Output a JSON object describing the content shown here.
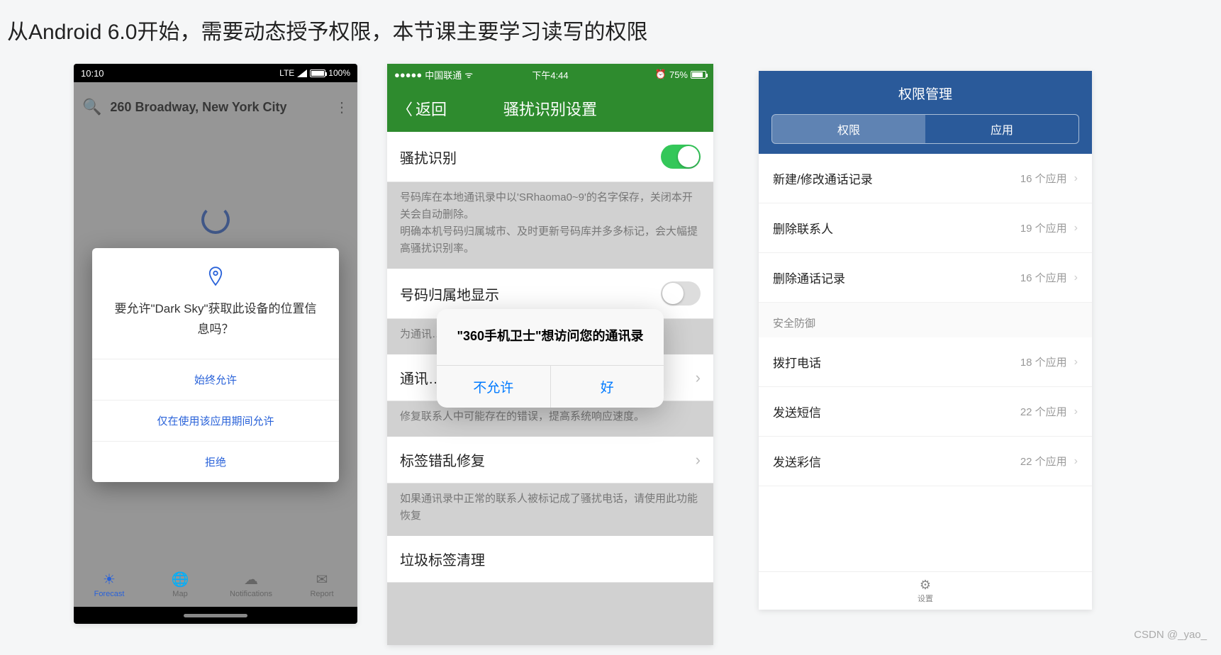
{
  "heading": "从Android 6.0开始，需要动态授予权限，本节课主要学习读写的权限",
  "watermark": "CSDN @_yao_",
  "phone1": {
    "status_time": "10:10",
    "status_lte": "LTE",
    "status_batt": "100%",
    "header_address": "260 Broadway, New York City",
    "dialog_text": "要允许\"Dark Sky\"获取此设备的位置信息吗？",
    "btn_always": "始终允许",
    "btn_while": "仅在使用该应用期间允许",
    "btn_deny": "拒绝",
    "tabs": [
      {
        "icon": "☀",
        "label": "Forecast"
      },
      {
        "icon": "🌐",
        "label": "Map"
      },
      {
        "icon": "☁",
        "label": "Notifications"
      },
      {
        "icon": "✉",
        "label": "Report"
      }
    ]
  },
  "phone2": {
    "carrier": "中国联通",
    "time": "下午4:44",
    "batt": "75%",
    "back": "返回",
    "title": "骚扰识别设置",
    "row1": "骚扰识别",
    "desc1": "号码库在本地通讯录中以'SRhaoma0~9'的名字保存，关闭本开关会自动删除。\n明确本机号码归属城市、及时更新号码库并多多标记，会大幅提高骚扰识别率。",
    "row2": "号码归属地显示",
    "desc2": "为通讯…",
    "row3": "通讯…",
    "desc3": "修复联系人中可能存在的错误，提高系统响应速度。",
    "row4": "标签错乱修复",
    "desc4": "如果通讯录中正常的联系人被标记成了骚扰电话，请使用此功能恢复",
    "row5": "垃圾标签清理",
    "alert_title": "\"360手机卫士\"想访问您的通讯录",
    "alert_deny": "不允许",
    "alert_ok": "好"
  },
  "phone3": {
    "title": "权限管理",
    "seg_perm": "权限",
    "seg_app": "应用",
    "items": [
      {
        "label": "新建/修改通话记录",
        "val": "16 个应用"
      },
      {
        "label": "删除联系人",
        "val": "19 个应用"
      },
      {
        "label": "删除通话记录",
        "val": "16 个应用"
      }
    ],
    "section": "安全防御",
    "items2": [
      {
        "label": "拨打电话",
        "val": "18 个应用"
      },
      {
        "label": "发送短信",
        "val": "22 个应用"
      },
      {
        "label": "发送彩信",
        "val": "22 个应用"
      }
    ],
    "bottom_label": "设置"
  }
}
